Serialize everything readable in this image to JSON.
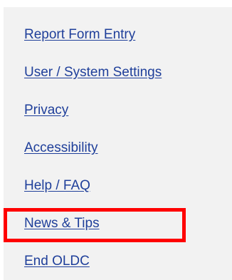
{
  "menu": {
    "items": [
      {
        "label": "Report Form Entry"
      },
      {
        "label": "User / System Settings"
      },
      {
        "label": "Privacy"
      },
      {
        "label": "Accessibility"
      },
      {
        "label": "Help / FAQ"
      },
      {
        "label": "News & Tips"
      },
      {
        "label": "End OLDC"
      }
    ]
  },
  "colors": {
    "panel_background": "#f2f2f2",
    "link": "#1f3f9a",
    "highlight": "#ff0000"
  }
}
